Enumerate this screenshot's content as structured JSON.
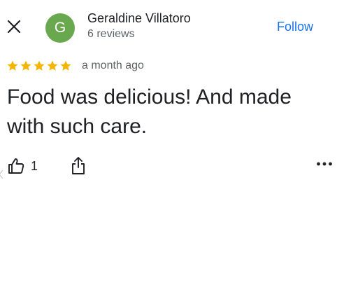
{
  "reviewer": {
    "avatar_initial": "G",
    "avatar_color": "#6aa84f",
    "name": "Geraldine Villatoro",
    "review_count": "6 reviews"
  },
  "header": {
    "close_icon": "close-icon",
    "follow_label": "Follow"
  },
  "review": {
    "rating": 5,
    "rating_max": 5,
    "star_color": "#f4b400",
    "time": "a month ago",
    "text": "Food was delicious! And made with such care."
  },
  "actions": {
    "like_icon": "thumbs-up-icon",
    "like_count": "1",
    "share_icon": "share-icon",
    "more_icon": "more-horizontal-icon"
  },
  "colors": {
    "link": "#1a73e8",
    "secondary_text": "#5f6368"
  }
}
